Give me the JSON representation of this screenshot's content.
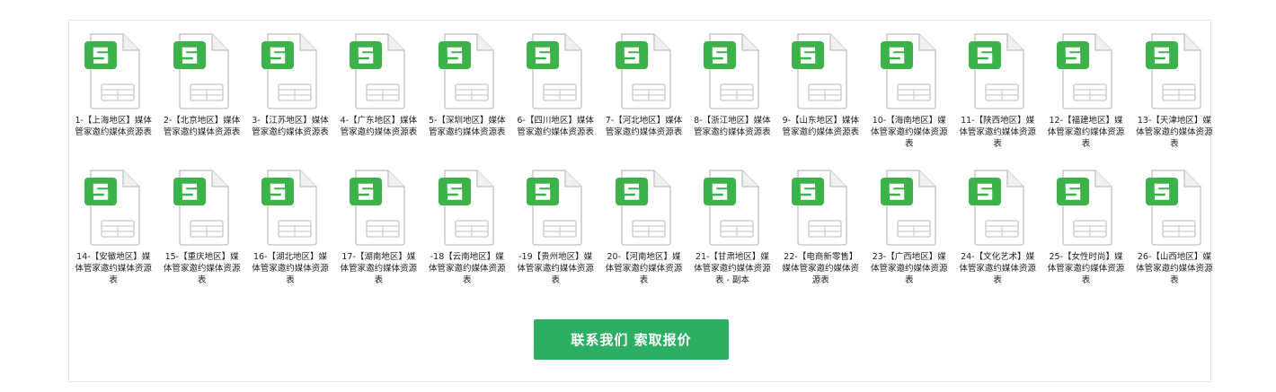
{
  "icons": {
    "file": "spreadsheet-file-icon",
    "accent": "#3cb34a",
    "cta_color": "#2daf63"
  },
  "files": [
    "1-【上海地区】媒体管家邀约媒体资源表",
    "2-【北京地区】媒体管家邀约媒体资源表",
    "3-【江苏地区】媒体管家邀约媒体资源表",
    "4-【广东地区】媒体管家邀约媒体资源表",
    "5-【深圳地区】媒体管家邀约媒体资源表",
    "6-【四川地区】媒体管家邀约媒体资源表",
    "7-【河北地区】媒体管家邀约媒体资源表",
    "8-【浙江地区】媒体管家邀约媒体资源表",
    "9-【山东地区】媒体管家邀约媒体资源表",
    "10-【海南地区】媒体管家邀约媒体资源表",
    "11-【陕西地区】媒体管家邀约媒体资源表",
    "12-【福建地区】媒体管家邀约媒体资源表",
    "13-【天津地区】媒体管家邀约媒体资源表",
    "14-【安徽地区】媒体管家邀约媒体资源表",
    "15-【重庆地区】媒体管家邀约媒体资源表",
    "16-【湖北地区】媒体管家邀约媒体资源表",
    "17-【湖南地区】媒体管家邀约媒体资源表",
    "-18【云南地区】媒体管家邀约媒体资源表",
    "-19【贵州地区】媒体管家邀约媒体资源表",
    "20-【河南地区】媒体管家邀约媒体资源表",
    "21-【甘肃地区】媒体管家邀约媒体资源表 - 副本",
    "22-【电商新零售】媒体管家邀约媒体资源表",
    "23-【广西地区】媒体管家邀约媒体资源表",
    "24-【文化艺术】媒体管家邀约媒体资源表",
    "25-【女性时尚】媒体管家邀约媒体资源表",
    "26-【山西地区】媒体管家邀约媒体资源表"
  ],
  "cta": {
    "label": "联系我们 索取报价"
  }
}
